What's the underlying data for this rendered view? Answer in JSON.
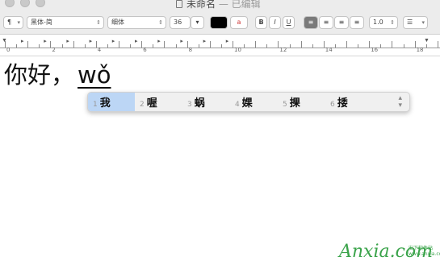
{
  "window": {
    "title": "未命名",
    "separator": "—",
    "status": "已编辑"
  },
  "toolbar": {
    "paragraph_style": "¶",
    "font_family": "黑体-简",
    "font_style": "细体",
    "font_size": "36",
    "text_color": "#000000",
    "bold_label": "B",
    "italic_label": "I",
    "underline_label": "U",
    "line_spacing": "1.0",
    "active_alignment": "left"
  },
  "ruler": {
    "numbers": [
      "0",
      "2",
      "4",
      "6",
      "8",
      "10",
      "12",
      "14",
      "16",
      "18"
    ]
  },
  "document": {
    "committed_text": "你好，",
    "marked_text": "wǒ"
  },
  "candidates": {
    "selected_index": 0,
    "items": [
      {
        "num": "1",
        "char": "我"
      },
      {
        "num": "2",
        "char": "喔"
      },
      {
        "num": "3",
        "char": "蜗"
      },
      {
        "num": "4",
        "char": "婐"
      },
      {
        "num": "5",
        "char": "捰"
      },
      {
        "num": "6",
        "char": "捼"
      }
    ]
  },
  "watermark": {
    "brand": "Anxia.com",
    "sub1": "安下软件站",
    "sub2": "www.anxia.com"
  }
}
